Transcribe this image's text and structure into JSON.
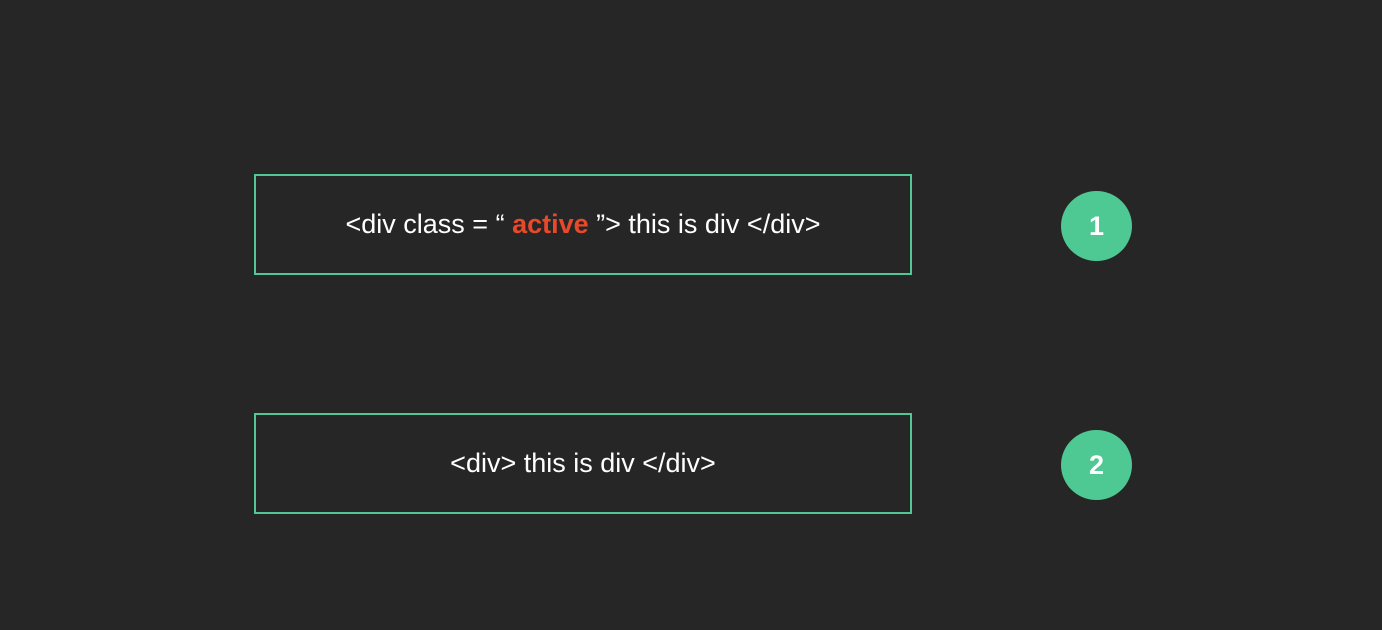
{
  "colors": {
    "background": "#262626",
    "accent": "#4fc994",
    "highlight": "#e8492b",
    "text": "#ffffff"
  },
  "items": [
    {
      "code_prefix": "<div class = “ ",
      "code_highlight": "active",
      "code_suffix": " ”> this is div </div>",
      "badge": "1"
    },
    {
      "code_text": "<div> this is div </div>",
      "badge": "2"
    }
  ]
}
